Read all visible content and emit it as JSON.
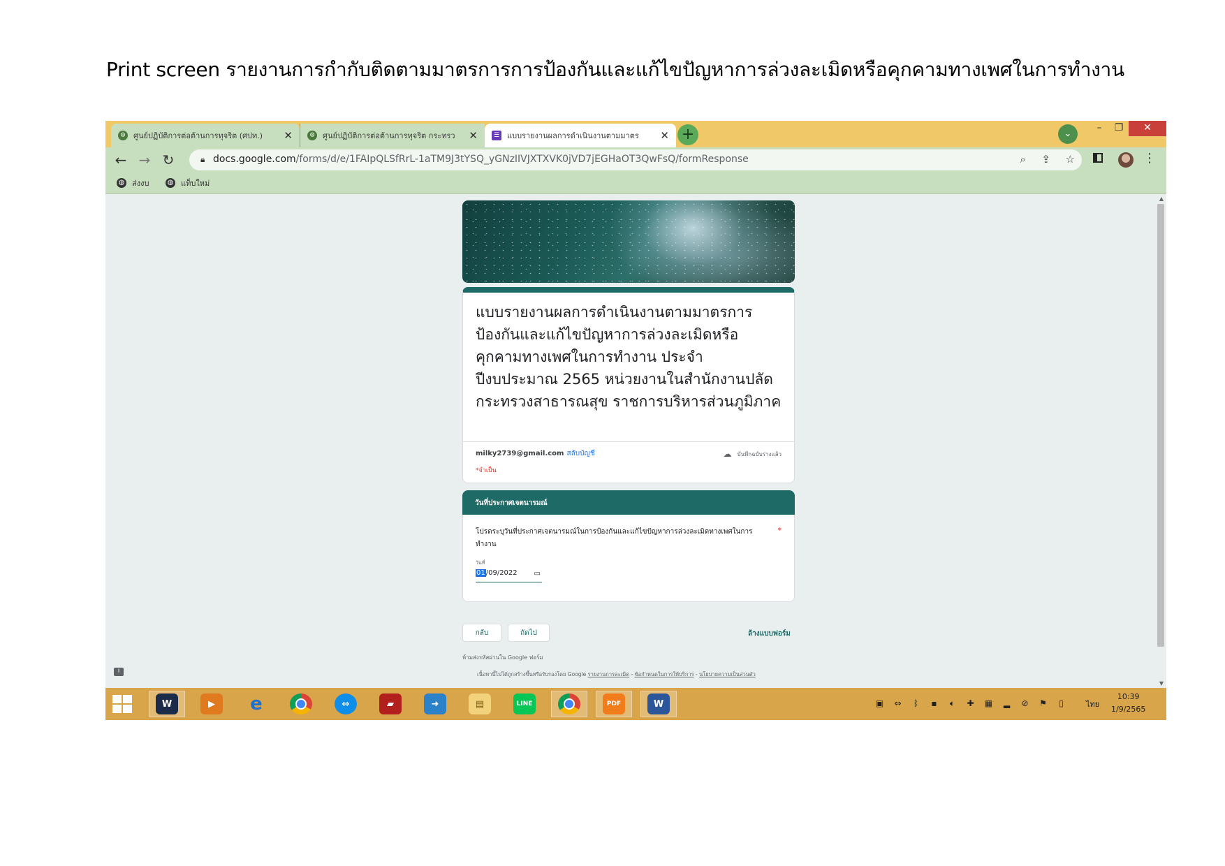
{
  "document_heading": "Print screen รายงานการกำกับติดตามมาตรการการป้องกันและแก้ไขปัญหาการล่วงละเมิดหรือคุกคามทางเพศในการทำงาน",
  "browser": {
    "tabs": [
      {
        "title": "ศูนย์ปฏิบัติการต่อต้านการทุจริต (ศปท.)",
        "icon": "site-favicon"
      },
      {
        "title": "ศูนย์ปฏิบัติการต่อต้านการทุจริต กระทรว",
        "icon": "site-favicon"
      },
      {
        "title": "แบบรายงานผลการดำเนินงานตามมาตร",
        "icon": "google-forms-favicon"
      }
    ],
    "url_host": "docs.google.com",
    "url_path": "/forms/d/e/1FAIpQLSfRrL-1aTM9J3tYSQ_yGNzIIVJXTXVK0jVD7jEGHaOT3QwFsQ/formResponse",
    "bookmarks": [
      "ส่งงบ",
      "แท็บใหม่"
    ]
  },
  "form": {
    "title": "แบบรายงานผลการดำเนินงานตามมาตรการป้องกันและแก้ไขปัญหาการล่วงละเมิดหรือคุกคามทางเพศในการทำงาน ประจำปีงบประมาณ 2565 หน่วยงานในสำนักงานปลัดกระทรวงสาธารณสุข  ราชการบริหารส่วนภูมิภาค",
    "email": "milky2739@gmail.com",
    "switch_account": "สลับบัญชี",
    "saved_status": "บันทึกฉบับร่างแล้ว",
    "required_note": "*จำเป็น",
    "section_title": "วันที่ประกาศเจตนารมณ์",
    "question": "โปรดระบุวันที่ประกาศเจตนารมณ์ในการป้องกันและแก้ไขปัญหาการล่วงละเมิดทางเพศในการทำงาน",
    "required_mark": "*",
    "date_label": "วันที่",
    "date_day": "01",
    "date_rest": "/09/2022",
    "back_button": "กลับ",
    "next_button": "ถัดไป",
    "clear_form": "ล้างแบบฟอร์ม",
    "password_notice": "ห้ามส่งรหัสผ่านใน Google ฟอร์ม",
    "footer_prefix": "เนื้อหานี้ไม่ได้ถูกสร้างขึ้นหรือรับรองโดย Google",
    "footer_links": [
      "รายงานการละเมิด",
      "ข้อกำหนดในการให้บริการ",
      "นโยบายความเป็นส่วนตัว"
    ]
  },
  "taskbar": {
    "apps": [
      "webex",
      "media",
      "internet-explorer",
      "chrome",
      "teamviewer",
      "book",
      "send",
      "file-explorer",
      "line",
      "chrome-active",
      "pdf",
      "word"
    ],
    "language": "ไทย",
    "time": "10:39",
    "date": "1/9/2565"
  },
  "colors": {
    "tab_strip": "#f0c868",
    "toolbar": "#c8dfbf",
    "form_accent": "#1d6a67",
    "page_bg": "#e9eeee",
    "taskbar": "#d9a54a"
  }
}
